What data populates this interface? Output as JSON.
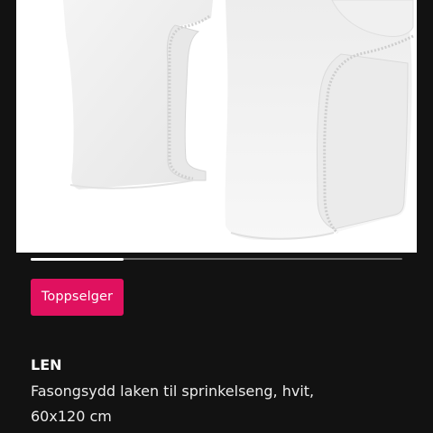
{
  "product": {
    "badge": "Toppselger",
    "name": "LEN",
    "description_line1": "Fasongsydd laken til sprinkelseng, hvit,",
    "description_line2": "60x120 cm",
    "image_alt": "Two white fitted crib sheets"
  },
  "carousel": {
    "progress": 0.25
  },
  "colors": {
    "background": "#121212",
    "badge": "#e0115f",
    "text": "#ffffff",
    "track": "#6b6b6b"
  }
}
